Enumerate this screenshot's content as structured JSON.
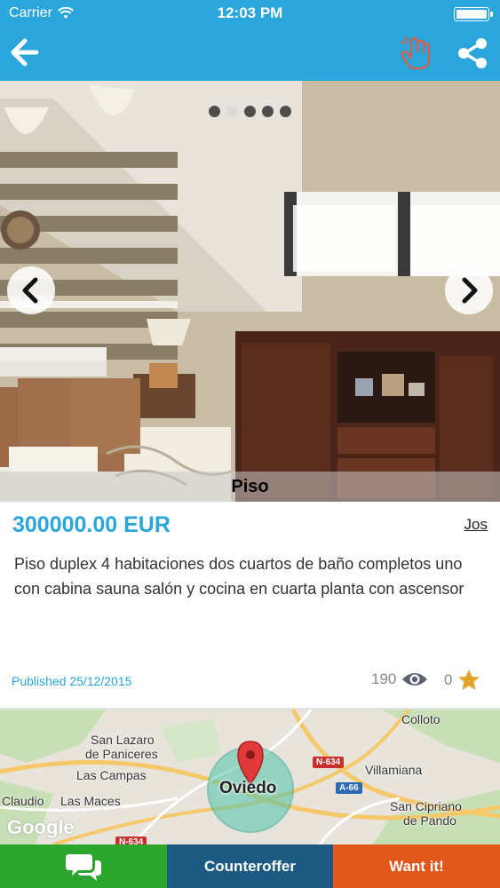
{
  "status_bar": {
    "carrier": "Carrier",
    "time": "12:03 PM",
    "battery_level": 1.0
  },
  "navbar": {
    "back_icon": "arrow-left-icon",
    "hand_icon": "hand-icon",
    "share_icon": "share-icon"
  },
  "carousel": {
    "dots_count": 5,
    "active_index": 1,
    "caption": "Piso"
  },
  "listing": {
    "price": "300000.00 EUR",
    "owner": "Jos",
    "description": "Piso duplex 4 habitaciones dos cuartos de baño completos uno con cabina sauna salón y cocina en cuarta planta con ascensor",
    "published": "Published 25/12/2015",
    "views": "190",
    "favorites": "0"
  },
  "map": {
    "city": "Oviedo",
    "labels": {
      "colloto": "Colloto",
      "san_lazaro": "San Lazaro",
      "de_paniceres": "de Paniceres",
      "las_campas": "Las Campas",
      "villamiana": "Villamiana",
      "claudio": "Claudio",
      "las_maces": "Las Maces",
      "san_cipriano": "San Cipriano",
      "de_pando": "de Pando"
    },
    "roads": {
      "n634_upper": "N-634",
      "a66": "A-66",
      "n634_lower": "N-634"
    },
    "attribution": "Google"
  },
  "bottom_bar": {
    "chat_icon": "chat-bubbles-icon",
    "counteroffer": "Counteroffer",
    "want": "Want it!"
  },
  "colors": {
    "primary": "#2aa6db",
    "chat": "#2ca52f",
    "counteroffer": "#1c5a82",
    "want": "#e1571c",
    "hand_icon": "#e05a4a",
    "star": "#e2a52b"
  }
}
